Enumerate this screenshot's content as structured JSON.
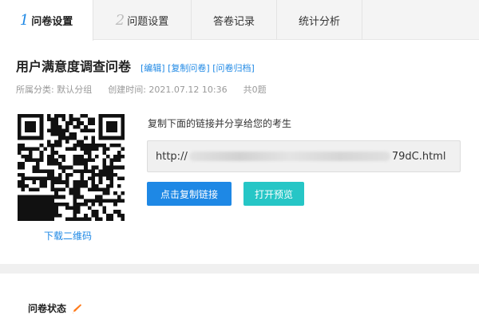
{
  "tabs": [
    {
      "num": "1",
      "label": "问卷设置",
      "active": true
    },
    {
      "num": "2",
      "label": "问题设置",
      "active": false
    },
    {
      "num": "",
      "label": "答卷记录",
      "active": false
    },
    {
      "num": "",
      "label": "统计分析",
      "active": false
    }
  ],
  "survey": {
    "title": "用户满意度调查问卷",
    "links": {
      "edit": "[编辑]",
      "copy": "[复制问卷]",
      "archive": "[问卷归档]"
    },
    "meta": {
      "category": "所属分类: 默认分组",
      "created": "创建时间: 2021.07.12 10:36",
      "count": "共0题"
    }
  },
  "share": {
    "instruction": "复制下面的链接并分享给您的考生",
    "url_prefix": "http://",
    "url_suffix": "79dC.html",
    "copy_button": "点击复制链接",
    "preview_button": "打开预览",
    "download_qr": "下载二维码"
  },
  "status": {
    "title": "问卷状态"
  },
  "colors": {
    "accent": "#1e88e5",
    "preview": "#26c6c6",
    "edit_icon": "#ff7a1a"
  },
  "icons": {
    "edit": "pencil-icon"
  }
}
